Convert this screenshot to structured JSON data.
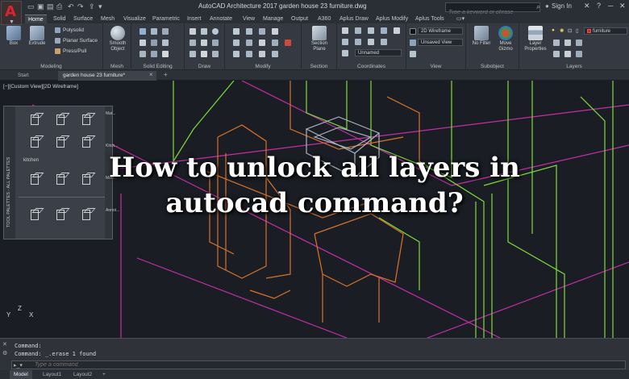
{
  "titlebar": {
    "app_letter": "A",
    "window_title": "AutoCAD Architecture 2017    garden house 23 furniture.dwg",
    "search_placeholder": "Type a keyword or phrase",
    "signin_label": "Sign In",
    "minimize": "─",
    "close": "✕"
  },
  "ribbon_tabs": [
    "Home",
    "Solid",
    "Surface",
    "Mesh",
    "Visualize",
    "Parametric",
    "Insert",
    "Annotate",
    "View",
    "Manage",
    "Output",
    "A360",
    "Aplus Draw",
    "Aplus Modify",
    "Aplus Tools"
  ],
  "ribbon": {
    "modeling": {
      "label": "Modeling",
      "box": "Box",
      "extrude": "Extrude",
      "polysolid": "Polysolid",
      "planar_surface": "Planar Surface",
      "presspull": "Press/Pull"
    },
    "mesh": {
      "label": "Mesh",
      "smooth_object": "Smooth Object"
    },
    "solid_editing": {
      "label": "Solid Editing"
    },
    "draw": {
      "label": "Draw"
    },
    "modify": {
      "label": "Modify"
    },
    "section": {
      "label": "Section",
      "section_plane": "Section Plane"
    },
    "coordinates": {
      "label": "Coordinates",
      "named": "Unnamed"
    },
    "view": {
      "label": "View",
      "visual_style": "2D Wireframe",
      "saved_view": "Unsaved View"
    },
    "subobject": {
      "label": "Subobject",
      "no_filter": "No Filter",
      "move_gizmo": "Move Gizmo"
    },
    "layers": {
      "label": "Layers",
      "layer_properties": "Layer Properties",
      "current_layer": "furniture"
    }
  },
  "file_tabs": {
    "start": "Start",
    "drawing": "garden house 23 furniture*",
    "close": "×",
    "new": "+"
  },
  "drawing": {
    "viewport_label": "[−][Custom View][2D Wireframe]",
    "headline_line1": "How to unlock all layers in",
    "headline_line2": "autocad command?",
    "ucs_y": "Y",
    "ucs_z": "Z",
    "ucs_x": "X"
  },
  "palette": {
    "title": "TOOL PALETTES - ALL PALETTES",
    "section_label": "kitchen",
    "side_tabs": [
      "Mat...",
      "Kitch...",
      "Mod...",
      "Annot..."
    ]
  },
  "command": {
    "line1": "Command:",
    "line2": "Command: _.erase 1 found",
    "placeholder": "Type a command"
  },
  "layout_tabs": [
    "Model",
    "Layout1",
    "Layout2",
    "+"
  ],
  "colors": {
    "wire_magenta": "#c22fa8",
    "wire_green": "#7fdc3a",
    "wire_orange": "#d9732a",
    "wire_gray": "#a9b3bd",
    "accent_red": "#d8262c"
  }
}
